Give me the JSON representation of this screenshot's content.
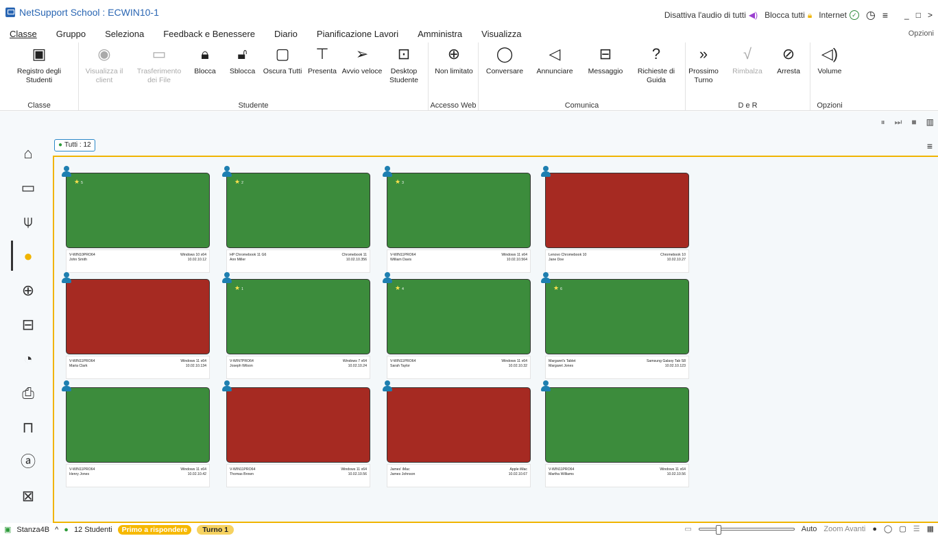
{
  "window": {
    "title": "NetSupport School : ECWIN10-1",
    "right_controls": [
      "Disattiva l'audio di tutti",
      "Blocca tutti",
      "Internet"
    ],
    "window_buttons": [
      "_",
      "□",
      ">"
    ]
  },
  "menu": {
    "items": [
      "Classe",
      "Gruppo",
      "Seleziona",
      "Feedback e Benessere",
      "Diario",
      "Pianificazione Lavori",
      "Amministra",
      "Visualizza"
    ],
    "options": "Opzioni"
  },
  "ribbon": {
    "groups": {
      "classe": "Classe",
      "studente": "Studente",
      "accesso": "Accesso Web",
      "comunica": "Comunica",
      "der": "D e R",
      "opzioni": "Opzioni"
    },
    "buttons": {
      "registro": "Registro degli Studenti",
      "visualizza": "Visualizza il client",
      "trasferimento": "Trasferimento dei File",
      "blocca": "Blocca",
      "sblocca": "Sblocca",
      "oscura": "Oscura Tutti",
      "presenta": "Presenta",
      "avvio": "Avvio veloce",
      "desktop": "Desktop Studente",
      "non_limitato": "Non limitato",
      "conversare": "Conversare",
      "annunciare": "Annunciare",
      "messaggio": "Messaggio",
      "richieste": "Richieste di Guida",
      "prossimo": "Prossimo Turno",
      "rimbalza": "Rimbalza",
      "arresta": "Arresta",
      "volume": "Volume"
    }
  },
  "view": {
    "tutti_tag": "Tutti : 12"
  },
  "students": [
    {
      "machine": "V-WIN10PRO64",
      "name": "John Smith",
      "os": "Windows 10 x64",
      "ip": "10.02.10.12",
      "color": "#3c8c3c",
      "star": true,
      "star_num": "5"
    },
    {
      "machine": "HP Chromebook 11 G6",
      "name": "Ann Miller",
      "os": "Chromebook 11",
      "ip": "10.02.10.356",
      "color": "#3c8c3c",
      "star": true,
      "star_num": "2"
    },
    {
      "machine": "V-WIN11PRO64",
      "name": "William Davis",
      "os": "Windows 11 x64",
      "ip": "10.02.10.564",
      "color": "#3c8c3c",
      "star": true,
      "star_num": "3"
    },
    {
      "machine": "Lenovo Chromebook 10",
      "name": "Jane Doe",
      "os": "Chromebook 10",
      "ip": "10.02.10.27",
      "color": "#a62a22",
      "star": false,
      "star_num": ""
    },
    {
      "machine": "V-WIN11PRO64",
      "name": "Maria Clark",
      "os": "Windows 11 x64",
      "ip": "10.02.10.134",
      "color": "#a62a22",
      "star": false,
      "star_num": ""
    },
    {
      "machine": "V-WIN7PRO64",
      "name": "Joseph Wilson",
      "os": "Windows 7 x64",
      "ip": "10.02.10.24",
      "color": "#3c8c3c",
      "star": true,
      "star_num": "1"
    },
    {
      "machine": "V-WIN11PRO64",
      "name": "Sarah Taylor",
      "os": "Windows 11 x64",
      "ip": "10.02.10.32",
      "color": "#3c8c3c",
      "star": true,
      "star_num": "4"
    },
    {
      "machine": "Margaret's Tablet",
      "name": "Margaret Jones",
      "os": "Samsung Galaxy Tab S8",
      "ip": "10.02.10.123",
      "color": "#3c8c3c",
      "star": true,
      "star_num": "6"
    },
    {
      "machine": "V-WIN11PRO64",
      "name": "Henry Jones",
      "os": "Windows 11 x64",
      "ip": "10.02.10.42",
      "color": "#3c8c3c",
      "star": false,
      "star_num": ""
    },
    {
      "machine": "V-WIN11PRO64",
      "name": "Thomas Brown",
      "os": "Windows 11 x64",
      "ip": "10.02.10.56",
      "color": "#a62a22",
      "star": false,
      "star_num": ""
    },
    {
      "machine": "James' iMac",
      "name": "James Johnson",
      "os": "Apple iMac",
      "ip": "10.02.10.67",
      "color": "#a62a22",
      "star": false,
      "star_num": ""
    },
    {
      "machine": "V-WIN11PRO64",
      "name": "Martha Williams",
      "os": "Windows 11 x64",
      "ip": "10.02.10.56",
      "color": "#3c8c3c",
      "star": false,
      "star_num": ""
    }
  ],
  "status": {
    "room": "Stanza4B",
    "students": "12 Studenti",
    "first_responder": "Primo a rispondere",
    "turn": "Turno 1",
    "auto": "Auto",
    "zoom": "Zoom Avanti"
  }
}
